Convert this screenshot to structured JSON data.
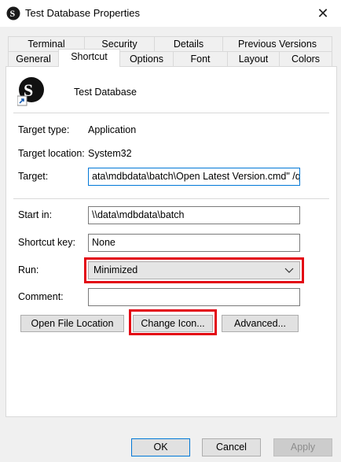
{
  "window": {
    "title": "Test Database Properties",
    "close_glyph": "✕",
    "icon": "app-logo-icon"
  },
  "tabs_top": [
    {
      "label": "Terminal"
    },
    {
      "label": "Security"
    },
    {
      "label": "Details"
    },
    {
      "label": "Previous Versions"
    }
  ],
  "tabs_bottom": [
    {
      "label": "General"
    },
    {
      "label": "Shortcut",
      "active": true
    },
    {
      "label": "Options"
    },
    {
      "label": "Font"
    },
    {
      "label": "Layout"
    },
    {
      "label": "Colors"
    }
  ],
  "shortcut": {
    "name": "Test Database",
    "target_type_label": "Target type:",
    "target_type_value": "Application",
    "target_location_label": "Target location:",
    "target_location_value": "System32",
    "target_label": "Target:",
    "target_value": "ata\\mdbdata\\batch\\Open Latest Version.cmd\" /q",
    "start_in_label": "Start in:",
    "start_in_value": "\\\\data\\mdbdata\\batch",
    "shortcut_key_label": "Shortcut key:",
    "shortcut_key_value": "None",
    "run_label": "Run:",
    "run_value": "Minimized",
    "comment_label": "Comment:",
    "comment_value": "",
    "open_location_label": "Open File Location",
    "change_icon_label": "Change Icon...",
    "advanced_label": "Advanced..."
  },
  "footer": {
    "ok_label": "OK",
    "cancel_label": "Cancel",
    "apply_label": "Apply"
  },
  "colors": {
    "highlight": "#e30613",
    "accent": "#0078d7"
  }
}
